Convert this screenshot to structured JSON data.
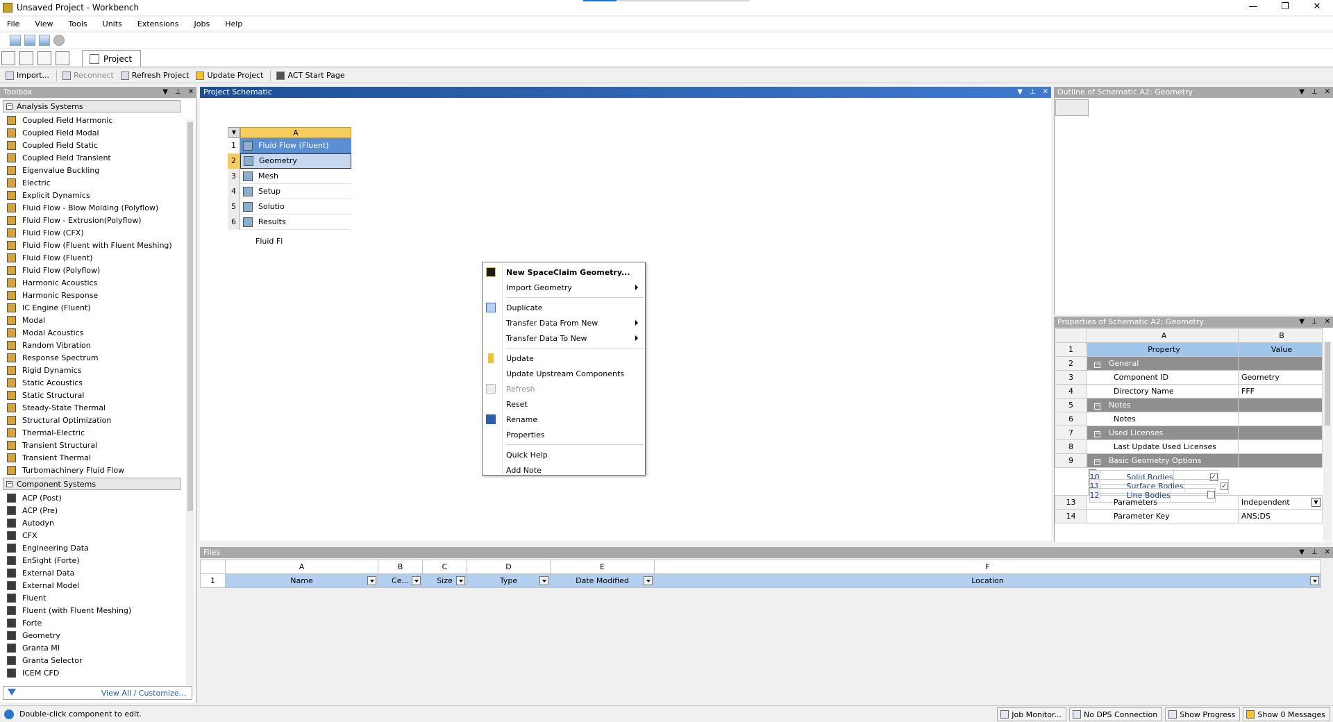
{
  "window": {
    "title": "Unsaved Project - Workbench",
    "minimize": "—",
    "maximize": "❐",
    "close": "✕"
  },
  "menu": [
    "File",
    "View",
    "Tools",
    "Units",
    "Extensions",
    "Jobs",
    "Help"
  ],
  "tab": {
    "label": "Project"
  },
  "toolbar": {
    "import": "Import...",
    "reconnect": "Reconnect",
    "refresh": "Refresh Project",
    "update": "Update Project",
    "act": "ACT Start Page"
  },
  "panels": {
    "toolbox": "Toolbox",
    "schematic": "Project Schematic",
    "outline": "Outline of Schematic A2: Geometry",
    "properties": "Properties of Schematic A2: Geometry",
    "files": "Files"
  },
  "toolbox": {
    "analysis_group": "Analysis Systems",
    "analysis_items": [
      "Coupled Field Harmonic",
      "Coupled Field Modal",
      "Coupled Field Static",
      "Coupled Field Transient",
      "Eigenvalue Buckling",
      "Electric",
      "Explicit Dynamics",
      "Fluid Flow - Blow Molding (Polyflow)",
      "Fluid Flow - Extrusion(Polyflow)",
      "Fluid Flow (CFX)",
      "Fluid Flow (Fluent with Fluent Meshing)",
      "Fluid Flow (Fluent)",
      "Fluid Flow (Polyflow)",
      "Harmonic Acoustics",
      "Harmonic Response",
      "IC Engine (Fluent)",
      "Modal",
      "Modal Acoustics",
      "Random Vibration",
      "Response Spectrum",
      "Rigid Dynamics",
      "Static Acoustics",
      "Static Structural",
      "Steady-State Thermal",
      "Structural Optimization",
      "Thermal-Electric",
      "Transient Structural",
      "Transient Thermal",
      "Turbomachinery Fluid Flow"
    ],
    "component_group": "Component Systems",
    "component_items": [
      "ACP (Post)",
      "ACP (Pre)",
      "Autodyn",
      "CFX",
      "Engineering Data",
      "EnSight (Forte)",
      "External Data",
      "External Model",
      "Fluent",
      "Fluent (with Fluent Meshing)",
      "Forte",
      "Geometry",
      "Granta MI",
      "Granta Selector",
      "ICEM CFD"
    ],
    "footer": "View All / Customize..."
  },
  "system": {
    "column": "A",
    "rows": [
      {
        "num": "1",
        "label": "Fluid Flow (Fluent)"
      },
      {
        "num": "2",
        "label": "Geometry"
      },
      {
        "num": "3",
        "label": "Mesh"
      },
      {
        "num": "4",
        "label": "Setup"
      },
      {
        "num": "5",
        "label": "Solutio"
      },
      {
        "num": "6",
        "label": "Results"
      }
    ],
    "caption": "Fluid Fl"
  },
  "context_menu": {
    "new_spaceclaim": "New SpaceClaim Geometry...",
    "import_geometry": "Import Geometry",
    "duplicate": "Duplicate",
    "transfer_from": "Transfer Data From New",
    "transfer_to": "Transfer Data To New",
    "update": "Update",
    "update_upstream": "Update Upstream Components",
    "refresh": "Refresh",
    "reset": "Reset",
    "rename": "Rename",
    "properties": "Properties",
    "quick_help": "Quick Help",
    "add_note": "Add Note"
  },
  "properties": {
    "col_a": "A",
    "col_b": "B",
    "rows": [
      {
        "n": "1",
        "a": "Property",
        "b": "Value",
        "kind": "hdr"
      },
      {
        "n": "2",
        "a": "General",
        "b": "",
        "kind": "grp"
      },
      {
        "n": "3",
        "a": "Component ID",
        "b": "Geometry",
        "kind": "row"
      },
      {
        "n": "4",
        "a": "Directory Name",
        "b": "FFF",
        "kind": "row"
      },
      {
        "n": "5",
        "a": "Notes",
        "b": "",
        "kind": "grp"
      },
      {
        "n": "6",
        "a": "Notes",
        "b": "",
        "kind": "row"
      },
      {
        "n": "7",
        "a": "Used Licenses",
        "b": "",
        "kind": "grp"
      },
      {
        "n": "8",
        "a": "Last Update Used Licenses",
        "b": "",
        "kind": "row"
      },
      {
        "n": "9",
        "a": "Basic Geometry Options",
        "b": "",
        "kind": "grp"
      },
      {
        "n": "10",
        "a": "Solid Bodies",
        "b": "✓",
        "kind": "chk"
      },
      {
        "n": "11",
        "a": "Surface Bodies",
        "b": "✓",
        "kind": "chk"
      },
      {
        "n": "12",
        "a": "Line Bodies",
        "b": "",
        "kind": "chk"
      },
      {
        "n": "13",
        "a": "Parameters",
        "b": "Independent",
        "kind": "row"
      },
      {
        "n": "14",
        "a": "Parameter Key",
        "b": "ANS;DS",
        "kind": "row"
      }
    ]
  },
  "files": {
    "letters": [
      "A",
      "B",
      "C",
      "D",
      "E",
      "F"
    ],
    "row_num": "1",
    "names": [
      "Name",
      "Ce...",
      "Size",
      "Type",
      "Date Modified",
      "Location"
    ]
  },
  "status": {
    "message": "Double-click component to edit.",
    "job_monitor": "Job Monitor...",
    "dps": "No DPS Connection",
    "progress": "Show Progress",
    "messages": "Show 0 Messages"
  }
}
